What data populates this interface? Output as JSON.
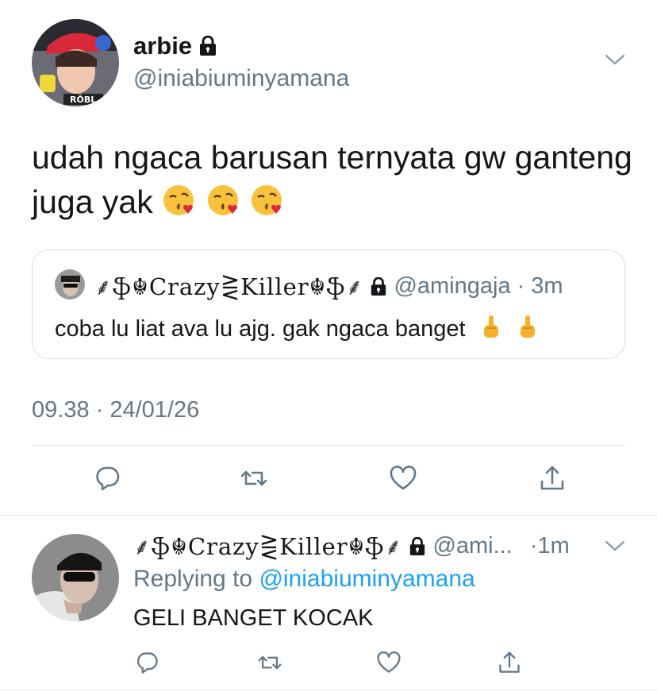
{
  "tweet": {
    "author_name": "arbie",
    "author_handle": "@iniabiuminyamana",
    "text": "udah ngaca barusan ternyata gw ganteng juga yak",
    "emojis": [
      "kissing-heart-emoji",
      "kissing-heart-emoji",
      "kissing-heart-emoji"
    ],
    "timestamp": "09.38 · 24/01/26"
  },
  "quote": {
    "display_name": "⸙ֆ☬Crazy⋛Killer☬ֆ⸙",
    "handle": "@amingaja",
    "separator": "·",
    "age": "3m",
    "text": "coba lu liat ava lu ajg. gak ngaca banget",
    "emojis": [
      "middle-finger-emoji",
      "middle-finger-emoji"
    ]
  },
  "reply": {
    "display_name": "⸙ֆ☬Crazy⋛Killer☬ֆ⸙",
    "handle": "@ami...",
    "age": "·1m",
    "replying_label": "Replying to",
    "replying_handle": "@iniabiuminyamana",
    "text": "GELI BANGET KOCAK"
  },
  "icons": {
    "reply": "reply-icon",
    "retweet": "retweet-icon",
    "like": "heart-icon",
    "share": "share-icon",
    "lock": "lock-icon",
    "chevron": "chevron-down-icon"
  },
  "colors": {
    "text": "#14171a",
    "muted": "#657786",
    "link": "#1da1f2",
    "border": "#e1e8ed"
  }
}
